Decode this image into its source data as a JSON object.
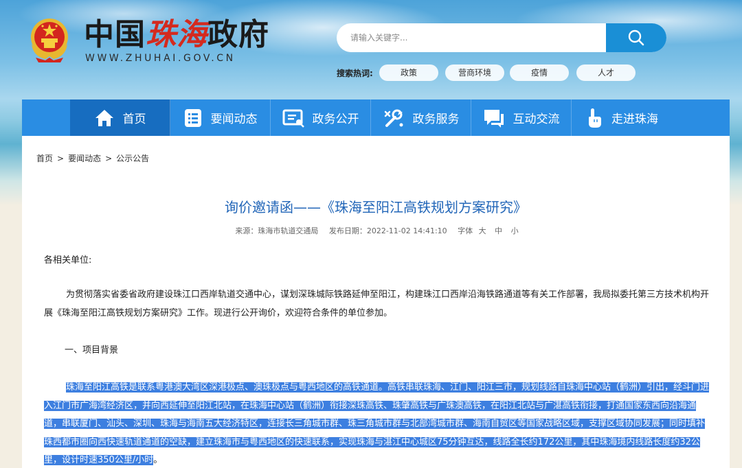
{
  "header": {
    "logo_part1": "中国",
    "logo_part2": "珠海",
    "logo_part3": "政府",
    "url": "WWW.ZHUHAI.GOV.CN",
    "search_placeholder": "请输入关键字...",
    "hot_label": "搜索热词:",
    "hot_tags": [
      "政策",
      "营商环境",
      "疫情",
      "人才"
    ]
  },
  "nav": {
    "items": [
      {
        "label": "首页",
        "icon": "home-icon"
      },
      {
        "label": "要闻动态",
        "icon": "list-icon"
      },
      {
        "label": "政务公开",
        "icon": "document-icon"
      },
      {
        "label": "政务服务",
        "icon": "service-icon"
      },
      {
        "label": "互动交流",
        "icon": "chat-icon"
      },
      {
        "label": "走进珠海",
        "icon": "hand-pointer-icon"
      }
    ]
  },
  "breadcrumb": {
    "items": [
      "首页",
      ">",
      "要闻动态",
      ">",
      "公示公告"
    ]
  },
  "article": {
    "title": "询价邀请函——《珠海至阳江高铁规划方案研究》",
    "meta_source": "来源：珠海市轨道交通局",
    "meta_date": "发布日期：2022-11-02 14:41:10",
    "meta_font": "字体",
    "meta_font_sizes": [
      "大",
      "中",
      "小"
    ],
    "salutation": "各相关单位:",
    "paragraph1": "为贯彻落实省委省政府建设珠江口西岸轨道交通中心，谋划深珠城际铁路延伸至阳江，构建珠江口西岸沿海铁路通道等有关工作部署，我局拟委托第三方技术机构开展《珠海至阳江高铁规划方案研究》工作。现进行公开询价，欢迎符合条件的单位参加。",
    "section1": "一、项目背景",
    "paragraph2": "珠海至阳江高铁是联系粤港澳大湾区深港极点、澳珠极点与粤西地区的高铁通道。高铁串联珠海、江门、阳江三市，规划线路自珠海中心站（鹤洲）引出，经斗门进入江门市广海湾经济区，并向西延伸至阳江北站，在珠海中心站（鹤洲）衔接深珠高铁、珠肇高铁与广珠澳高铁，在阳江北站与广湛高铁衔接，打通国家东西向沿海通道，串联厦门、汕头、深圳、珠海与海南五大经济特区，连接长三角城市群、珠三角城市群与北部湾城市群、海南自贸区等国家战略区域，支撑区域协同发展；同时填补珠西都市圈向西快速轨道通道的空缺，建立珠海市与粤西地区的快速联系，实现珠海与湛江中心城区75分钟互达，线路全长约172公里，其中珠海境内线路长度约32公里，设计时速350公里/小时",
    "paragraph2_end": "。"
  },
  "colors": {
    "nav_bg": "#2a8de3",
    "nav_active": "#176dc0",
    "title_blue": "#2266b8",
    "highlight": "#3d7fe0",
    "logo_red": "#d42a1e"
  }
}
